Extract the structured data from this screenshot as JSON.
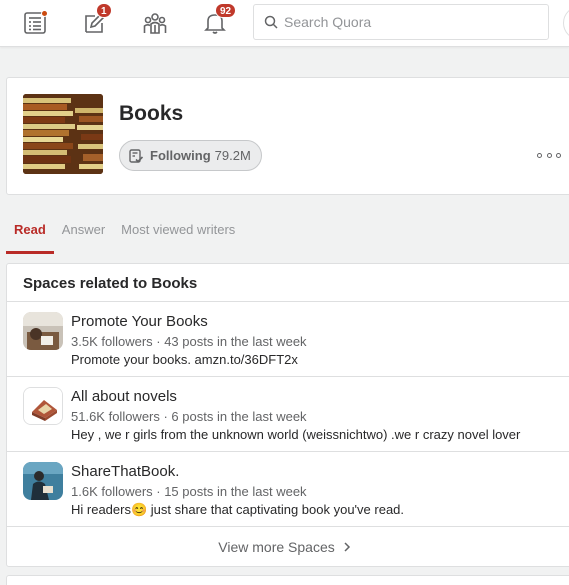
{
  "nav": {
    "icons": [
      "home-feed-icon",
      "answer-pencil-icon",
      "spaces-people-icon",
      "notifications-bell-icon"
    ],
    "answer_badge": "1",
    "notifications_badge": "92"
  },
  "search": {
    "placeholder": "Search Quora"
  },
  "topic": {
    "title": "Books",
    "follow_label": "Following",
    "follow_count": "79.2M"
  },
  "tabs": [
    {
      "label": "Read",
      "active": true
    },
    {
      "label": "Answer",
      "active": false
    },
    {
      "label": "Most viewed writers",
      "active": false
    }
  ],
  "spaces": {
    "title": "Spaces related to Books",
    "items": [
      {
        "name": "Promote Your Books",
        "meta": "3.5K followers · 43 posts in the last week",
        "desc": "Promote your books. amzn.to/36DFT2x"
      },
      {
        "name": "All about novels",
        "meta": "51.6K followers · 6 posts in the last week",
        "desc": "Hey , we r girls from the unknown world (weissnichtwo) .we r crazy novel lover"
      },
      {
        "name": "ShareThatBook.",
        "meta": "1.6K followers · 15 posts in the last week",
        "desc": "Hi readers😊 just share that captivating book you've read."
      }
    ],
    "view_more": "View more Spaces"
  },
  "colors": {
    "accent": "#b92b27",
    "badge": "#c0392b",
    "muted": "#636466"
  }
}
